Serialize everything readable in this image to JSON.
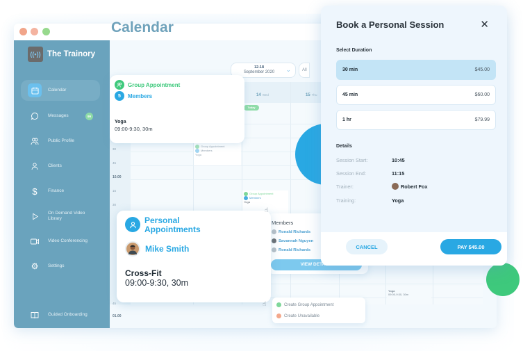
{
  "app": {
    "name": "The Trainory",
    "logo_icon": "signal-icon"
  },
  "sidebar": {
    "items": [
      {
        "label": "Calendar",
        "icon": "calendar-icon",
        "active": true
      },
      {
        "label": "Messages",
        "icon": "chat-icon",
        "badge": "99"
      },
      {
        "label": "Public Profile",
        "icon": "users-icon"
      },
      {
        "label": "Clients",
        "icon": "user-icon"
      },
      {
        "label": "Finance",
        "icon": "dollar-icon"
      },
      {
        "label": "On Demand Video Library",
        "icon": "play-icon"
      },
      {
        "label": "Video Conferencing",
        "icon": "video-icon"
      },
      {
        "label": "Settings",
        "icon": "gear-icon"
      },
      {
        "label": "Guided Onboarding",
        "icon": "book-icon"
      }
    ]
  },
  "calendar": {
    "title": "Calendar",
    "date_range": "12-18",
    "month": "September 2020",
    "filter_label": "All",
    "today_label": "Today",
    "days": [
      {
        "num": "14",
        "name": "Wed"
      },
      {
        "num": "15",
        "name": "Thu"
      }
    ],
    "time_ticks": [
      "30",
      "45",
      "10.00",
      "15",
      "30",
      "45",
      "01.00"
    ],
    "mini_events": [
      {
        "type": "Group Appointment",
        "members": "Members",
        "training": "Yoga",
        "time": "09:00-9:30, 30m"
      }
    ],
    "yoga_event": {
      "training": "Yoga",
      "time": "09:00-9:30, 30m"
    }
  },
  "group_popup": {
    "type_label": "Group Appointment",
    "members_count": "5",
    "members_label": "Members",
    "training": "Yoga",
    "time": "09:00-9:30, 30m"
  },
  "personal_popup": {
    "type_label": "Personal Appointments",
    "client_name": "Mike Smith",
    "training": "Cross-Fit",
    "time": "09:00-9:30, 30m"
  },
  "members_popup": {
    "title": "Members",
    "members": [
      "Ronald Richards",
      "Savannah Nguyen",
      "Ronald Richards"
    ],
    "button_label": "VIEW DETAILS"
  },
  "context_menu": {
    "items": [
      {
        "label": "Create Group Appointment",
        "color": "#7fd79a"
      },
      {
        "label": "Create Unavailable",
        "color": "#f3a88c"
      }
    ]
  },
  "booking_modal": {
    "title": "Book a Personal Session",
    "select_duration_label": "Select Duration",
    "durations": [
      {
        "label": "30 min",
        "price": "$45.00",
        "selected": true
      },
      {
        "label": "45 min",
        "price": "$60.00",
        "selected": false
      },
      {
        "label": "1 hr",
        "price": "$79.99",
        "selected": false
      }
    ],
    "details_label": "Details",
    "details": [
      {
        "key": "Session Start:",
        "value": "10:45"
      },
      {
        "key": "Session End:",
        "value": "11:15"
      },
      {
        "key": "Trainer:",
        "value": "Robert Fox"
      },
      {
        "key": "Training:",
        "value": "Yoga"
      }
    ],
    "cancel_label": "CANCEL",
    "pay_label": "PAY $45.00"
  },
  "colors": {
    "accent": "#29a8e3",
    "sidebar": "#6aa3bd",
    "green": "#3ec97c"
  }
}
